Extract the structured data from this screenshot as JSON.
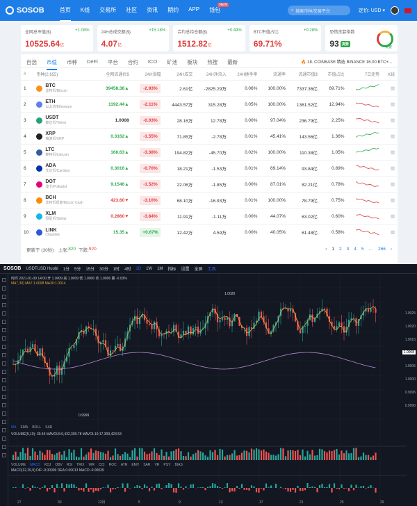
{
  "nav": {
    "brand": "SOSOB",
    "links": [
      "首页",
      "K线",
      "交易所",
      "社区",
      "资讯",
      "期约",
      "APP",
      "钱包"
    ],
    "hot_badge": "NEW",
    "search_placeholder": "搜索币种/交易平台",
    "currency": "定价: USD",
    "colors": {
      "bar": "#1e7de6"
    }
  },
  "stats": [
    {
      "label": "全网总市值($)",
      "pct": "+1.08%",
      "value": "10525.64",
      "unit": "亿"
    },
    {
      "label": "24H总成交额($)",
      "pct": "+15.18%",
      "value": "4.07",
      "unit": "亿"
    },
    {
      "label": "合约总持仓额($)",
      "pct": "+0.49%",
      "value": "1512.82",
      "unit": "亿"
    },
    {
      "label": "BTC市值占比",
      "pct": "+0.28%",
      "value": "69.71%",
      "unit": ""
    },
    {
      "label": "恐慌贪婪指数",
      "pct": "",
      "value": "93",
      "unit": "",
      "badge": "贪婪",
      "gauge_label": "贪婪"
    }
  ],
  "tabs": [
    "自选",
    "市值",
    "币种",
    "DeFi",
    "平台",
    "合约",
    "ICO",
    "矿池",
    "板块",
    "热搜",
    "最新"
  ],
  "active_tab": 1,
  "ticker": "18. COINBASE 精选 BINANCE 16.00 BTC+...",
  "table": {
    "headers": [
      "#",
      "币种(2,655)",
      "全网流通价$",
      "24H涨幅",
      "24H成交",
      "24H净流入",
      "24H换手率",
      "流通率",
      "流通市值$",
      "市值占比",
      "7日走势",
      "K线"
    ],
    "rows": [
      {
        "rank": "1",
        "sym": "BTC",
        "name": "比特币/Bitcoin",
        "price": "39458.38",
        "arrow": "▲",
        "chg": "-2.93%",
        "vol": "2.61亿",
        "flow": "-2825.29万",
        "turn": "0.06%",
        "circ": "100.00%",
        "mcap": "7337.36亿",
        "share": "69.71%",
        "color": "#f7931a",
        "dir": "up",
        "cdir": "dn",
        "trend": "up"
      },
      {
        "rank": "2",
        "sym": "ETH",
        "name": "以太坊/Ethereum",
        "price": "1192.44",
        "arrow": "▲",
        "chg": "-2.11%",
        "vol": "4443.57万",
        "flow": "315.28万",
        "turn": "0.05%",
        "circ": "100.00%",
        "mcap": "1361.52亿",
        "share": "12.94%",
        "color": "#627eea",
        "dir": "up",
        "cdir": "dn",
        "trend": "dn"
      },
      {
        "rank": "3",
        "sym": "USDT",
        "name": "泰达币/Tether",
        "price": "1.0008",
        "arrow": "",
        "chg": "-0.03%",
        "vol": "28.16万",
        "flow": "12.78万",
        "turn": "0.00%",
        "circ": "97.04%",
        "mcap": "236.79亿",
        "share": "2.25%",
        "color": "#26a17b",
        "dir": "flat",
        "cdir": "dn",
        "trend": "dn"
      },
      {
        "rank": "4",
        "sym": "XRP",
        "name": "瑞波币/XRP",
        "price": "0.3162",
        "arrow": "▲",
        "chg": "-1.55%",
        "vol": "71.85万",
        "flow": "-2.78万",
        "turn": "0.01%",
        "circ": "45.41%",
        "mcap": "143.56亿",
        "share": "1.36%",
        "color": "#222222",
        "dir": "up",
        "cdir": "dn",
        "trend": "up"
      },
      {
        "rank": "5",
        "sym": "LTC",
        "name": "莱特币/Litecoin",
        "price": "166.63",
        "arrow": "▲",
        "chg": "-3.38%",
        "vol": "194.82万",
        "flow": "-45.70万",
        "turn": "0.02%",
        "circ": "100.00%",
        "mcap": "110.38亿",
        "share": "1.05%",
        "color": "#345d9d",
        "dir": "up",
        "cdir": "dn",
        "trend": "up"
      },
      {
        "rank": "6",
        "sym": "ADA",
        "name": "艾达币/Cardano",
        "price": "0.3016",
        "arrow": "▲",
        "chg": "-0.70%",
        "vol": "18.21万",
        "flow": "-1.53万",
        "turn": "0.01%",
        "circ": "69.14%",
        "mcap": "93.84亿",
        "share": "0.89%",
        "color": "#0033ad",
        "dir": "up",
        "cdir": "dn",
        "trend": "dn"
      },
      {
        "rank": "7",
        "sym": "DOT",
        "name": "波卡/Polkadot",
        "price": "9.1546",
        "arrow": "▲",
        "chg": "-1.52%",
        "vol": "22.06万",
        "flow": "-1.85万",
        "turn": "0.00%",
        "circ": "87.01%",
        "mcap": "82.21亿",
        "share": "0.78%",
        "color": "#e6007a",
        "dir": "up",
        "cdir": "dn",
        "trend": "dn"
      },
      {
        "rank": "8",
        "sym": "BCH",
        "name": "比特币现金/Bitcoin Cash",
        "price": "423.60",
        "arrow": "▼",
        "chg": "-3.10%",
        "vol": "68.10万",
        "flow": "-16.93万",
        "turn": "0.01%",
        "circ": "100.00%",
        "mcap": "78.79亿",
        "share": "0.75%",
        "color": "#ff8c00",
        "dir": "dn",
        "cdir": "dn",
        "trend": "dn"
      },
      {
        "rank": "9",
        "sym": "XLM",
        "name": "恒星币/Stellar",
        "price": "0.2860",
        "arrow": "▼",
        "chg": "-3.84%",
        "vol": "11.91万",
        "flow": "-1.11万",
        "turn": "0.00%",
        "circ": "44.07%",
        "mcap": "63.02亿",
        "share": "0.60%",
        "color": "#14b6e7",
        "dir": "dn",
        "cdir": "dn",
        "trend": "dn"
      },
      {
        "rank": "10",
        "sym": "LINK",
        "name": "Chainlink",
        "price": "15.35",
        "arrow": "▲",
        "chg": "+0.67%",
        "vol": "12.42万",
        "flow": "4.59万",
        "turn": "0.00%",
        "circ": "40.05%",
        "mcap": "61.48亿",
        "share": "0.58%",
        "color": "#2a5ada",
        "dir": "up",
        "cdir": "up",
        "trend": "dn"
      }
    ]
  },
  "footer": {
    "updated": "更新于 (30秒)",
    "rise_label": "上涨:",
    "rise": "820",
    "fall_label": "下跌:",
    "fall": "920",
    "pages": [
      "‹",
      "1",
      "2",
      "3",
      "4",
      "5",
      "…",
      "266",
      "›"
    ]
  },
  "tv": {
    "brand": "SOSOB",
    "symbol": "USDTUSD Huobi",
    "toolbar": [
      "1分",
      "5分",
      "15分",
      "30分",
      "1时",
      "4时",
      "1D",
      "1W",
      "1M"
    ],
    "tools": [
      "指标",
      "设置",
      "全屏",
      "工具"
    ],
    "info_line": "时间 2021-01-09 14:00  开 1.0009  高 1.0009  低 1.0006  收 1.0006  量 -0.03%",
    "ma_line": "MA7,30)  MA7:1.0008  MA30:1.0014",
    "high_label": "1.0020",
    "low_label": "0.9999",
    "last_price": "1.0008",
    "price_axis": [
      "1.0025",
      "1.0020",
      "1.0015",
      "1.0010",
      "1.0005",
      "1.0000",
      "0.9995",
      "0.9990"
    ],
    "date_axis": [
      "27",
      "30",
      "12月",
      "5",
      "9",
      "13",
      "17",
      "21",
      "25",
      "29"
    ],
    "ind_tabs": [
      "MA",
      "EMA",
      "BOLL",
      "SAR"
    ],
    "vol_info": "VOLUME(5,10): 39.45  MAVOL5:9,432,309.78  MAVOL10:17,309,423.53",
    "vol_tabs": [
      "VOLUME",
      "MACD",
      "KDJ",
      "OBV",
      "RSI",
      "TRIX",
      "WR",
      "CCI",
      "ROC",
      "ATR",
      "EMV",
      "SAR",
      "VR",
      "PSY",
      "BIAS"
    ],
    "macd_info": "MACD(12,26,9)  DIF:-0.00009  DEA:0.00013  MACD:-0.00039"
  }
}
